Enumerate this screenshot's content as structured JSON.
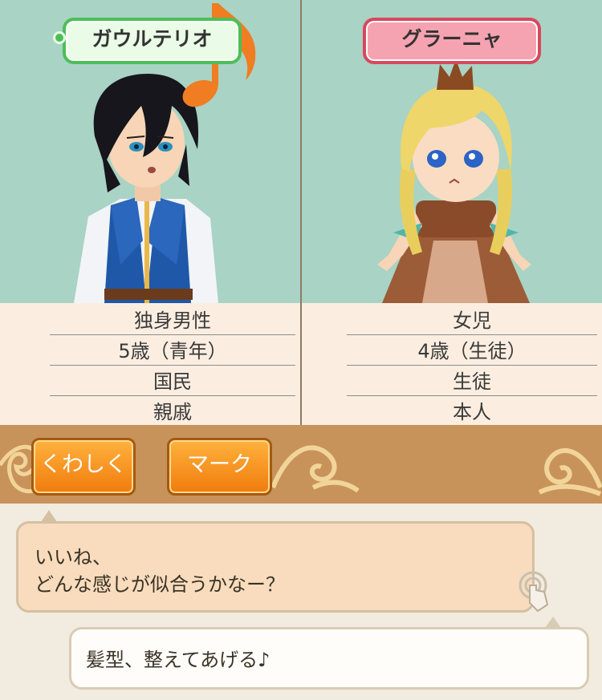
{
  "characters": {
    "left": {
      "name": "ガウルテリオ",
      "info": [
        "独身男性",
        "5歳（青年）",
        "国民",
        "親戚"
      ]
    },
    "right": {
      "name": "グラーニャ",
      "info": [
        "女児",
        "4歳（生徒）",
        "生徒",
        "本人"
      ]
    }
  },
  "buttons": {
    "detail_label": "くわしく",
    "mark_label": "マーク"
  },
  "dialogue": {
    "line1": "いいね、",
    "line2": "どんな感じが似合うかなー？",
    "reply": "髪型、整えてあげる♪"
  },
  "colors": {
    "left_tag": "#4bbf57",
    "right_tag": "#d9475c",
    "button": "#f07b0d",
    "panel_bg": "#a9d3c4"
  },
  "icons": [
    "music-note-icon",
    "tap-hand-icon"
  ]
}
